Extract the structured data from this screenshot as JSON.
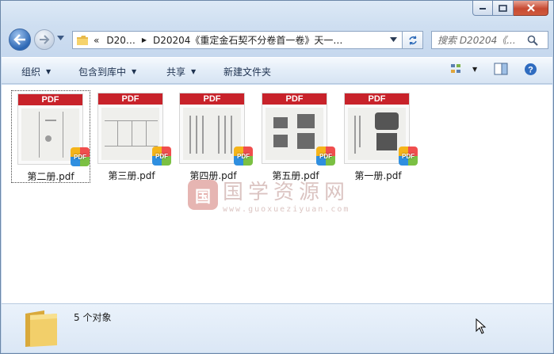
{
  "window": {
    "buttons": {
      "minimize": "minimize",
      "maximize": "maximize",
      "close": "close"
    }
  },
  "address": {
    "crumbs": [
      "«",
      "D20…",
      "D20204《重定金石契不分卷首一卷》天一…"
    ],
    "icon": "folder-icon"
  },
  "search": {
    "placeholder": "搜索 D20204《..."
  },
  "toolbar": {
    "organize": "组织",
    "include_library": "包含到库中",
    "share": "共享",
    "new_folder": "新建文件夹"
  },
  "files": [
    {
      "name": "第二册.pdf",
      "thumb_label": "PDF",
      "selected": true
    },
    {
      "name": "第三册.pdf",
      "thumb_label": "PDF",
      "selected": false
    },
    {
      "name": "第四册.pdf",
      "thumb_label": "PDF",
      "selected": false
    },
    {
      "name": "第五册.pdf",
      "thumb_label": "PDF",
      "selected": false
    },
    {
      "name": "第一册.pdf",
      "thumb_label": "PDF",
      "selected": false
    }
  ],
  "badge_label": "PDF",
  "watermark": {
    "seal": "国",
    "text": "国学资源网",
    "url": "www.guoxueziyuan.com"
  },
  "details": {
    "count": "5 个对象"
  },
  "colors": {
    "pdf_band": "#c8222a",
    "toolbar_text": "#1e3250",
    "close_button": "#c74a32"
  }
}
